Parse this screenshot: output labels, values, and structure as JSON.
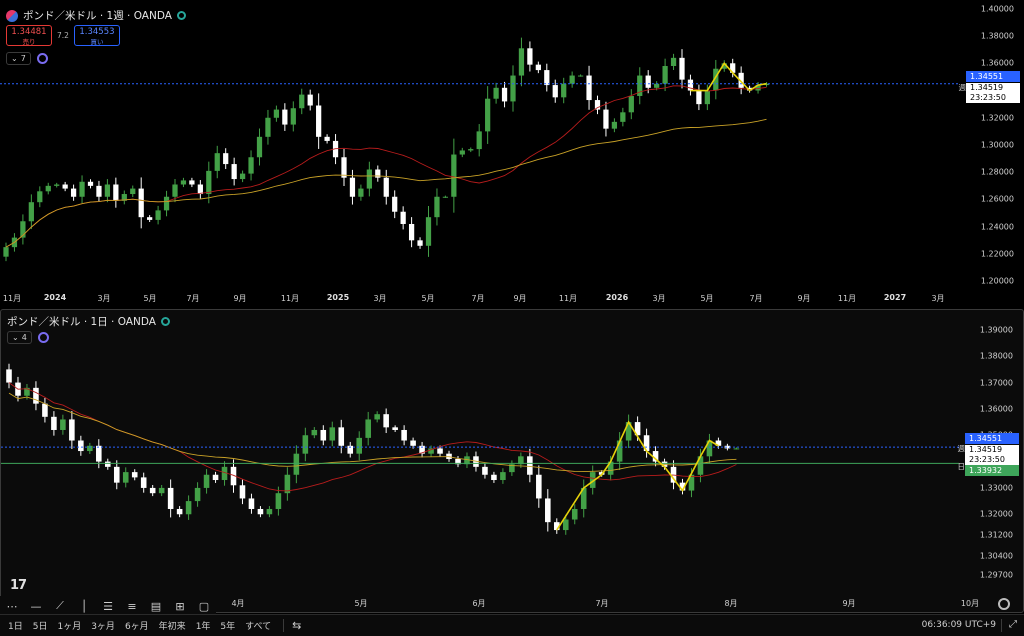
{
  "top_pane": {
    "title": "ポンド／米ドル · 1週 · OANDA",
    "sell": {
      "price": "1.34481",
      "label": "売り"
    },
    "buy": {
      "price": "1.34553",
      "label": "買い"
    },
    "spread": "7.2",
    "indicator_count": "7",
    "y_ticks": [
      "1.40000",
      "1.38000",
      "1.36000",
      "1.34000",
      "1.32000",
      "1.30000",
      "1.28000",
      "1.26000",
      "1.24000",
      "1.22000",
      "1.20000"
    ],
    "x_ticks": [
      {
        "label": "11月",
        "year": false
      },
      {
        "label": "2024",
        "year": true
      },
      {
        "label": "3月",
        "year": false
      },
      {
        "label": "5月",
        "year": false
      },
      {
        "label": "7月",
        "year": false
      },
      {
        "label": "9月",
        "year": false
      },
      {
        "label": "11月",
        "year": false
      },
      {
        "label": "2025",
        "year": true
      },
      {
        "label": "3月",
        "year": false
      },
      {
        "label": "5月",
        "year": false
      },
      {
        "label": "7月",
        "year": false
      },
      {
        "label": "9月",
        "year": false
      },
      {
        "label": "11月",
        "year": false
      },
      {
        "label": "2026",
        "year": true
      },
      {
        "label": "3月",
        "year": false
      },
      {
        "label": "5月",
        "year": false
      },
      {
        "label": "7月",
        "year": false
      },
      {
        "label": "9月",
        "year": false
      },
      {
        "label": "11月",
        "year": false
      },
      {
        "label": "2027",
        "year": true
      },
      {
        "label": "3月",
        "year": false
      }
    ],
    "tags": {
      "ask": "1.34551",
      "last": "1.34519",
      "countdown": "23:23:50",
      "line_label": "週"
    }
  },
  "bottom_pane": {
    "title": "ポンド／米ドル · 1日 · OANDA",
    "indicator_count": "4",
    "y_ticks": [
      "1.39000",
      "1.38000",
      "1.37000",
      "1.36000",
      "1.35000",
      "1.34000",
      "1.33000",
      "1.32000",
      "1.31200",
      "1.30400",
      "1.29700"
    ],
    "x_ticks": [
      "4月",
      "5月",
      "6月",
      "7月",
      "8月",
      "9月",
      "10月"
    ],
    "tags": {
      "ask": "1.34551",
      "last": "1.34519",
      "countdown": "23:23:50",
      "daily": "1.33932",
      "line_label_w": "週",
      "line_label_d": "日"
    }
  },
  "drawing_tools": [
    "cursor-icon",
    "hline-icon",
    "trendline-icon",
    "vline-icon",
    "fib-icon",
    "fib-fan-icon",
    "pitchfork-icon",
    "grid-icon",
    "rect-icon"
  ],
  "ranges": [
    "1日",
    "5日",
    "1ヶ月",
    "3ヶ月",
    "6ヶ月",
    "年初来",
    "1年",
    "5年",
    "すべて"
  ],
  "clock": "06:36:09 UTC+9",
  "colors": {
    "up": "#43a047",
    "down": "#ffffff",
    "ma_fast": "#b71c1c",
    "ma_slow": "#c9a227",
    "zigzag": "#e6d20a",
    "blue_line": "#2962ff",
    "green_line": "#3ea55a"
  },
  "chart_data": [
    {
      "type": "candlestick",
      "title": "ポンド／米ドル · 1週 · OANDA",
      "ylim": [
        1.195,
        1.405
      ],
      "closes": [
        1.225,
        1.232,
        1.244,
        1.258,
        1.266,
        1.27,
        1.271,
        1.268,
        1.262,
        1.273,
        1.27,
        1.262,
        1.271,
        1.259,
        1.264,
        1.268,
        1.247,
        1.245,
        1.252,
        1.262,
        1.271,
        1.274,
        1.271,
        1.264,
        1.281,
        1.294,
        1.286,
        1.275,
        1.279,
        1.291,
        1.306,
        1.32,
        1.326,
        1.315,
        1.327,
        1.337,
        1.329,
        1.306,
        1.303,
        1.291,
        1.276,
        1.262,
        1.268,
        1.282,
        1.276,
        1.262,
        1.251,
        1.242,
        1.23,
        1.226,
        1.247,
        1.262,
        1.262,
        1.293,
        1.296,
        1.297,
        1.31,
        1.334,
        1.342,
        1.332,
        1.351,
        1.371,
        1.359,
        1.355,
        1.344,
        1.335,
        1.345,
        1.351,
        1.351,
        1.333,
        1.326,
        1.312,
        1.317,
        1.324,
        1.336,
        1.351,
        1.342,
        1.345,
        1.358,
        1.364,
        1.348,
        1.34,
        1.33,
        1.34,
        1.356,
        1.36,
        1.353,
        1.342,
        1.34,
        1.344,
        1.345
      ]
    },
    {
      "type": "candlestick",
      "title": "ポンド／米ドル · 1日 · OANDA",
      "ylim": [
        1.292,
        1.393
      ],
      "closes": [
        1.37,
        1.365,
        1.368,
        1.362,
        1.357,
        1.352,
        1.356,
        1.348,
        1.344,
        1.346,
        1.34,
        1.338,
        1.332,
        1.336,
        1.334,
        1.33,
        1.328,
        1.33,
        1.322,
        1.32,
        1.325,
        1.33,
        1.335,
        1.333,
        1.338,
        1.331,
        1.326,
        1.322,
        1.32,
        1.322,
        1.328,
        1.335,
        1.343,
        1.35,
        1.352,
        1.348,
        1.353,
        1.346,
        1.343,
        1.349,
        1.356,
        1.358,
        1.353,
        1.352,
        1.348,
        1.346,
        1.343,
        1.345,
        1.343,
        1.341,
        1.339,
        1.342,
        1.338,
        1.335,
        1.333,
        1.336,
        1.339,
        1.342,
        1.335,
        1.326,
        1.317,
        1.314,
        1.318,
        1.322,
        1.33,
        1.336,
        1.335,
        1.34,
        1.348,
        1.355,
        1.35,
        1.344,
        1.34,
        1.338,
        1.332,
        1.329,
        1.335,
        1.342,
        1.348,
        1.346,
        1.345,
        1.345
      ]
    }
  ]
}
